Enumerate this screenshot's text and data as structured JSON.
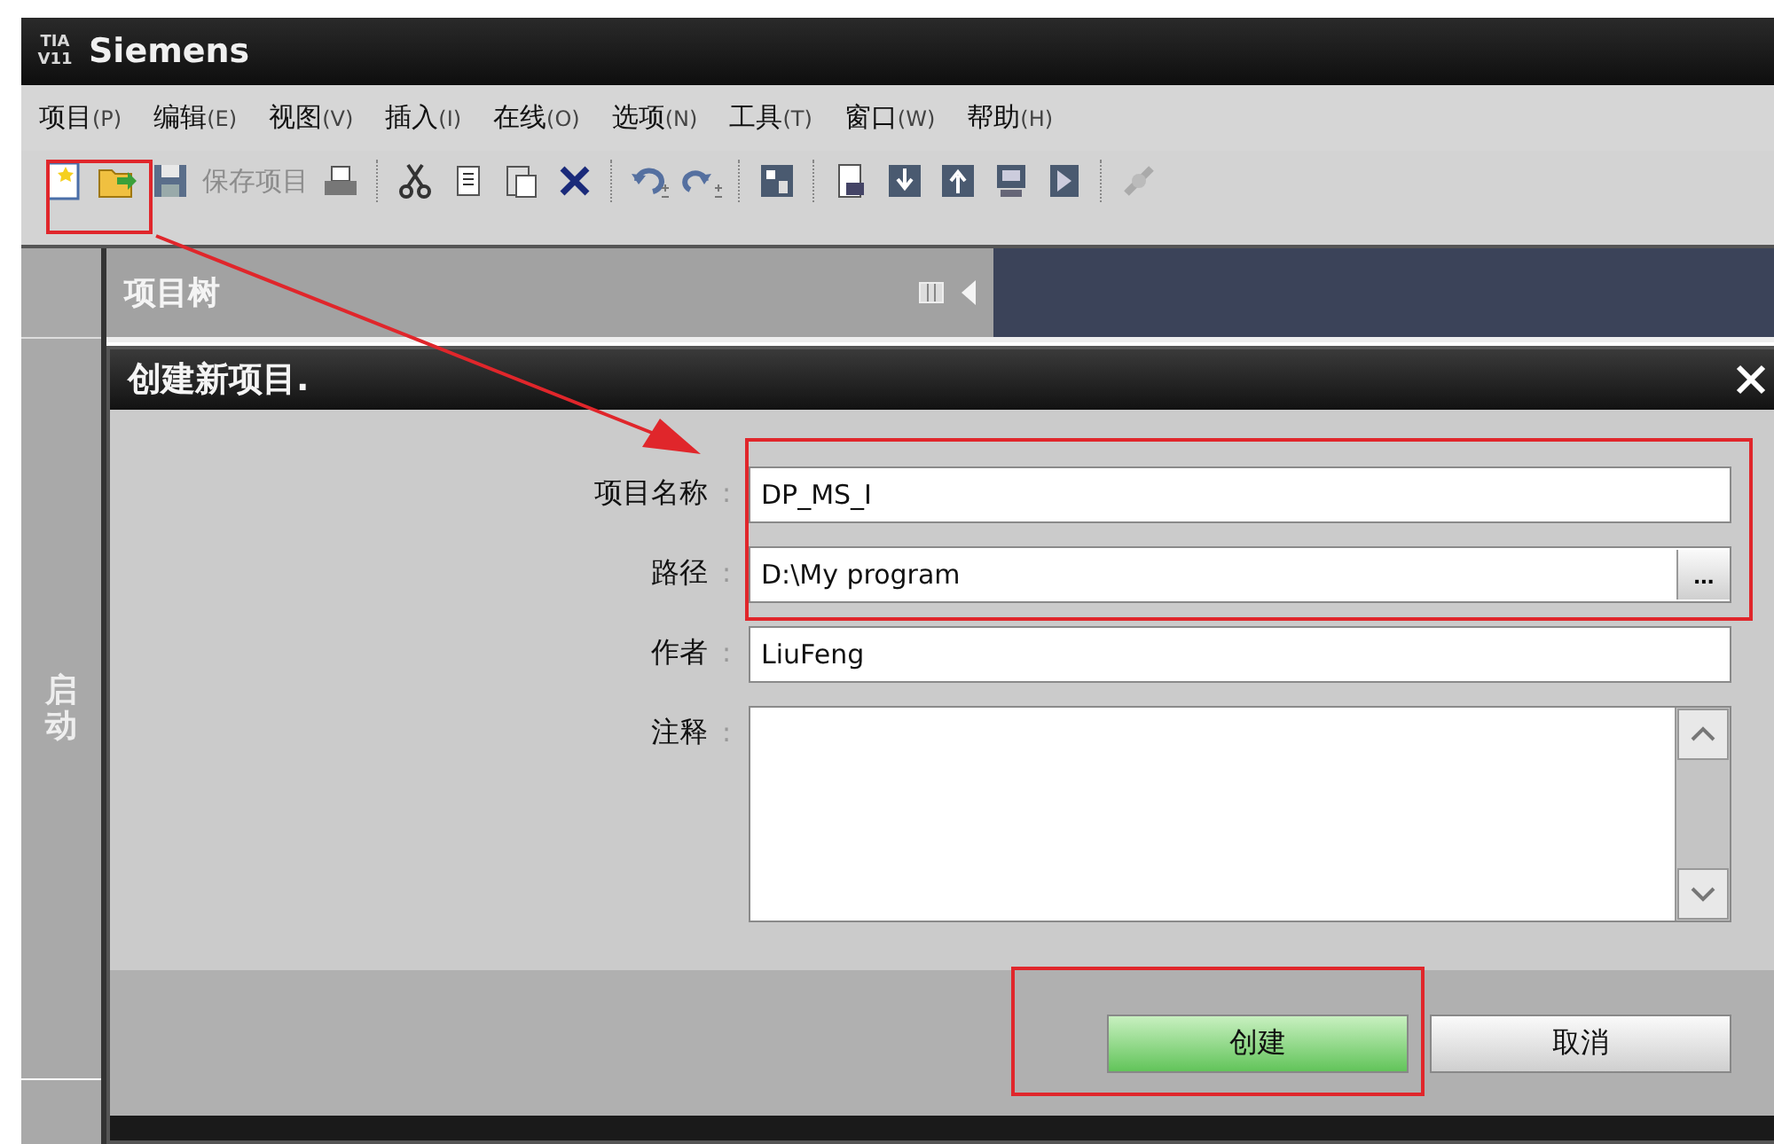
{
  "app": {
    "logo_top": "TIA",
    "logo_bottom": "V11",
    "title": "Siemens"
  },
  "menu": [
    {
      "label": "项目",
      "accel": "(P)"
    },
    {
      "label": "编辑",
      "accel": "(E)"
    },
    {
      "label": "视图",
      "accel": "(V)"
    },
    {
      "label": "插入",
      "accel": "(I)"
    },
    {
      "label": "在线",
      "accel": "(O)"
    },
    {
      "label": "选项",
      "accel": "(N)"
    },
    {
      "label": "工具",
      "accel": "(T)"
    },
    {
      "label": "窗口",
      "accel": "(W)"
    },
    {
      "label": "帮助",
      "accel": "(H)"
    }
  ],
  "toolbar": {
    "save_label": "保存项目",
    "save_disabled": true
  },
  "project_tree": {
    "title": "项目树"
  },
  "side_tab": {
    "label": "启动"
  },
  "dialog": {
    "title": "创建新项目.",
    "fields": [
      {
        "kind": "text",
        "label": "项目名称",
        "colon": ":",
        "value": "DP_MS_I"
      },
      {
        "kind": "browse",
        "label": "路径",
        "colon": ":",
        "value": "D:\\My program",
        "browse_label": "..."
      },
      {
        "kind": "text",
        "label": "作者",
        "colon": ":",
        "value": "LiuFeng"
      },
      {
        "kind": "multiline",
        "label": "注释",
        "colon": ":"
      }
    ],
    "buttons": [
      {
        "label": "创建",
        "primary": true
      },
      {
        "label": "取消",
        "primary": false
      }
    ]
  }
}
